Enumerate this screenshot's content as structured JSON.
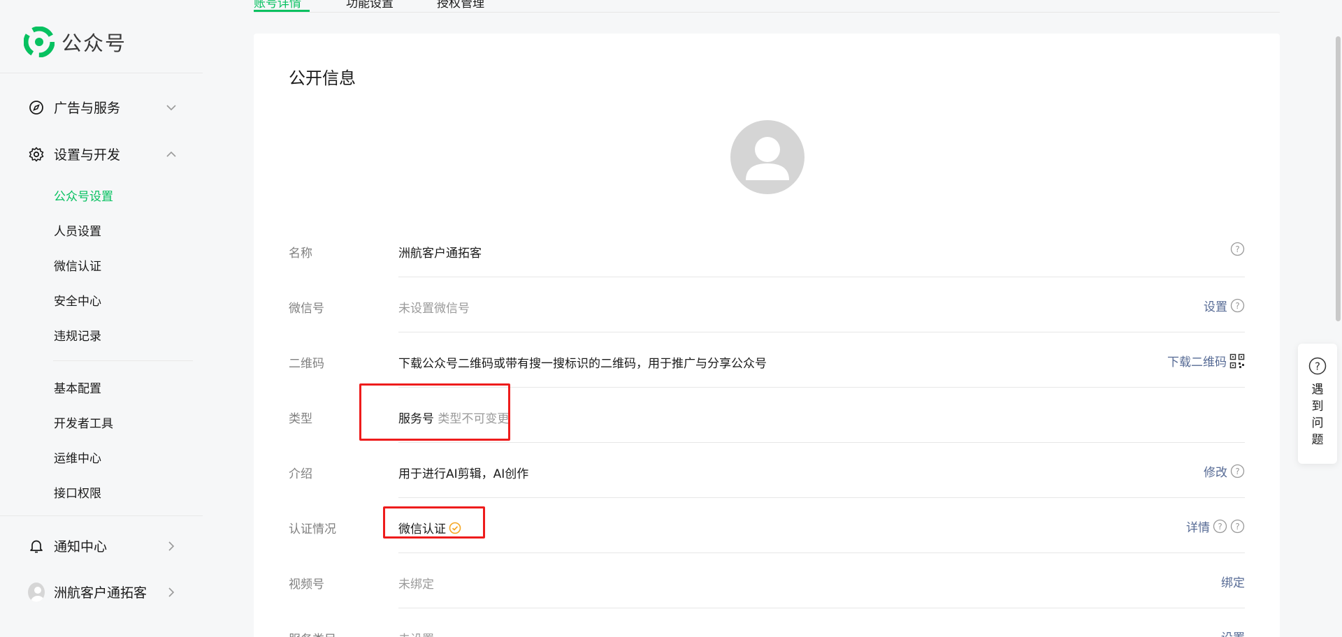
{
  "app": {
    "title": "公众号"
  },
  "sidebar": {
    "groups": [
      {
        "label": "广告与服务",
        "icon": "compass-icon",
        "expanded": false
      },
      {
        "label": "设置与开发",
        "icon": "gear-icon",
        "expanded": true
      },
      {
        "label": "通知中心",
        "icon": "bell-icon",
        "expanded": false
      },
      {
        "label": "洲航客户通拓客",
        "icon": "user-avatar-icon",
        "expanded": false
      }
    ],
    "settings_items": [
      {
        "label": "公众号设置",
        "active": true
      },
      {
        "label": "人员设置"
      },
      {
        "label": "微信认证"
      },
      {
        "label": "安全中心"
      },
      {
        "label": "违规记录"
      }
    ],
    "dev_items": [
      {
        "label": "基本配置"
      },
      {
        "label": "开发者工具"
      },
      {
        "label": "运维中心"
      },
      {
        "label": "接口权限"
      }
    ]
  },
  "tabs": [
    {
      "label": "账号详情",
      "active": true
    },
    {
      "label": "功能设置"
    },
    {
      "label": "授权管理"
    }
  ],
  "card": {
    "title": "公开信息",
    "rows": {
      "name": {
        "label": "名称",
        "value": "洲航客户通拓客"
      },
      "wechat_id": {
        "label": "微信号",
        "value": "未设置微信号",
        "action": "设置"
      },
      "qrcode": {
        "label": "二维码",
        "value": "下载公众号二维码或带有搜一搜标识的二维码，用于推广与分享公众号",
        "action": "下载二维码"
      },
      "type": {
        "label": "类型",
        "value": "服务号",
        "note": "类型不可变更"
      },
      "intro": {
        "label": "介绍",
        "value": "用于进行AI剪辑，AI创作",
        "action": "修改"
      },
      "verify": {
        "label": "认证情况",
        "value": "微信认证",
        "action": "详情"
      },
      "channels": {
        "label": "视频号",
        "value": "未绑定",
        "action": "绑定"
      },
      "category": {
        "label": "服务类目",
        "value": "未设置",
        "action": "设置"
      }
    }
  },
  "help": {
    "text": "遇到问题"
  },
  "colors": {
    "brand": "#07c160",
    "link": "#576b95",
    "highlight": "#ee1c1c",
    "verify_badge": "#f5a623"
  }
}
